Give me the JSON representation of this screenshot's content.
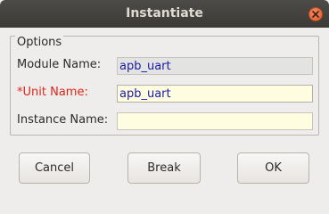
{
  "window": {
    "title": "Instantiate"
  },
  "options": {
    "legend": "Options",
    "module_name": {
      "label": "Module Name:",
      "value": "apb_uart"
    },
    "unit_name": {
      "label": "*Unit Name:",
      "value": "apb_uart"
    },
    "instance_name": {
      "label": "Instance Name:",
      "value": ""
    }
  },
  "buttons": {
    "cancel": "Cancel",
    "break": "Break",
    "ok": "OK"
  },
  "colors": {
    "required_label": "#e0241a",
    "field_text": "#1a1aa8",
    "editable_bg": "#fffddf",
    "close_button": "#e25c2b"
  }
}
